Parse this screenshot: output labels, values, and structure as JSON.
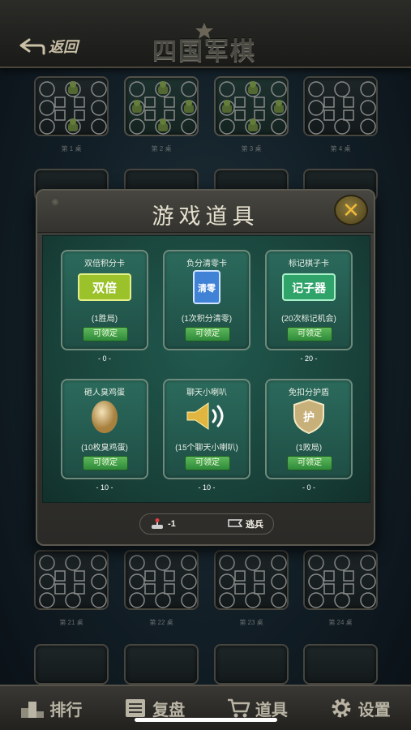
{
  "header": {
    "back_label": "返回",
    "logo_text": "四国军棋"
  },
  "tables": [
    {
      "label": "第 1 桌",
      "occupied": [
        true,
        false,
        false,
        true
      ]
    },
    {
      "label": "第 2 桌",
      "occupied": [
        true,
        true,
        true,
        true
      ]
    },
    {
      "label": "第 3 桌",
      "occupied": [
        true,
        true,
        true,
        true
      ]
    },
    {
      "label": "第 4 桌",
      "occupied": [
        false,
        false,
        false,
        false
      ]
    },
    {
      "label": "第 21 桌",
      "occupied": [
        false,
        false,
        false,
        false
      ]
    },
    {
      "label": "第 22 桌",
      "occupied": [
        false,
        false,
        false,
        false
      ]
    },
    {
      "label": "第 23 桌",
      "occupied": [
        false,
        false,
        false,
        false
      ]
    },
    {
      "label": "第 24 桌",
      "occupied": [
        false,
        false,
        false,
        false
      ]
    }
  ],
  "modal": {
    "title": "游戏道具",
    "items": [
      {
        "name": "双倍积分卡",
        "icon": "double-card-icon",
        "icon_text": "双倍",
        "desc": "(1胜局)",
        "button": "可领定",
        "count": "- 0 -"
      },
      {
        "name": "负分清零卡",
        "icon": "clear-card-icon",
        "icon_text": "清零",
        "desc": "(1次积分清零)",
        "button": "可领定",
        "count": ""
      },
      {
        "name": "标记棋子卡",
        "icon": "marker-card-icon",
        "icon_text": "记子器",
        "desc": "(20次标记机会)",
        "button": "可领定",
        "count": "- 20 -"
      },
      {
        "name": "砸人臭鸡蛋",
        "icon": "egg-icon",
        "icon_text": "",
        "desc": "(10枚臭鸡蛋)",
        "button": "可领定",
        "count": "- 10 -"
      },
      {
        "name": "聊天小喇叭",
        "icon": "speaker-icon",
        "icon_text": "",
        "desc": "(15个聊天小喇叭)",
        "button": "可领定",
        "count": "- 10 -"
      },
      {
        "name": "免扣分护盾",
        "icon": "shield-icon",
        "icon_text": "护",
        "desc": "(1败局)",
        "button": "可领定",
        "count": "- 0 -"
      }
    ],
    "footer": {
      "value": "-1",
      "escape_label": "逃兵"
    }
  },
  "nav": [
    {
      "label": "排行",
      "icon": "ranking-podium-icon"
    },
    {
      "label": "复盘",
      "icon": "replay-board-icon"
    },
    {
      "label": "道具",
      "icon": "shopping-cart-icon"
    },
    {
      "label": "设置",
      "icon": "gear-icon"
    }
  ],
  "colors": {
    "accent_gold": "#f0b93a",
    "button_green": "#3f9b45",
    "felt_green": "#1f4e45"
  }
}
